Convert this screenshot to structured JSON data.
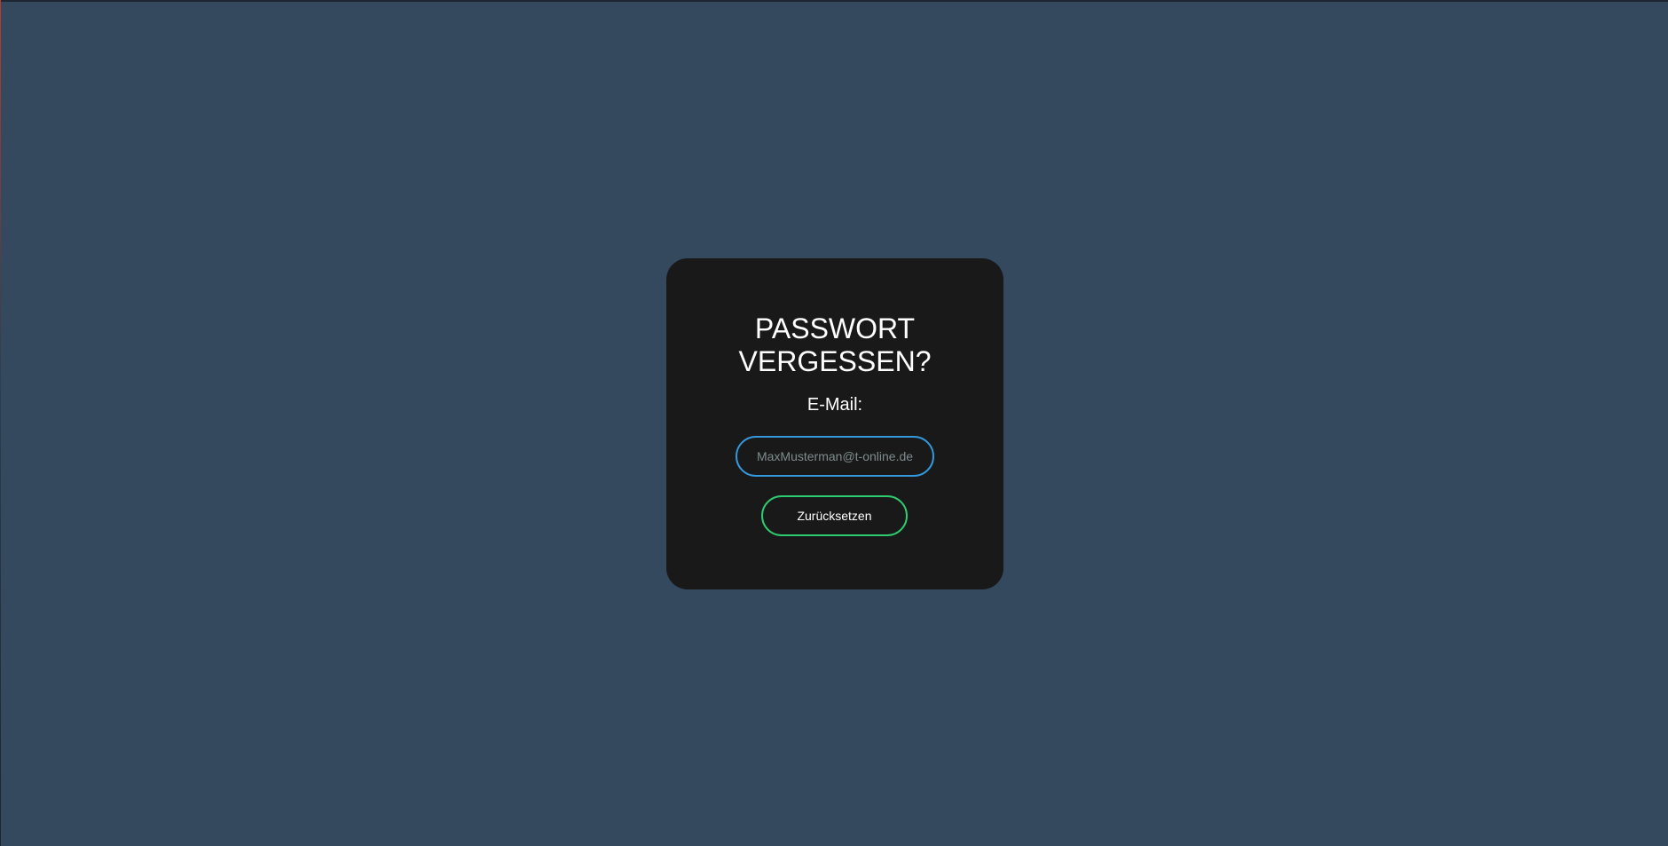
{
  "form": {
    "title_line1": "PASSWORT",
    "title_line2": "VERGESSEN?",
    "email_label": "E-Mail:",
    "email_placeholder": "MaxMusterman@t-online.de",
    "email_value": "",
    "submit_label": "Zurücksetzen"
  },
  "colors": {
    "background": "#34495e",
    "card": "#191919",
    "input_border": "#3498db",
    "button_border": "#2ecc71",
    "text": "#ffffff"
  }
}
